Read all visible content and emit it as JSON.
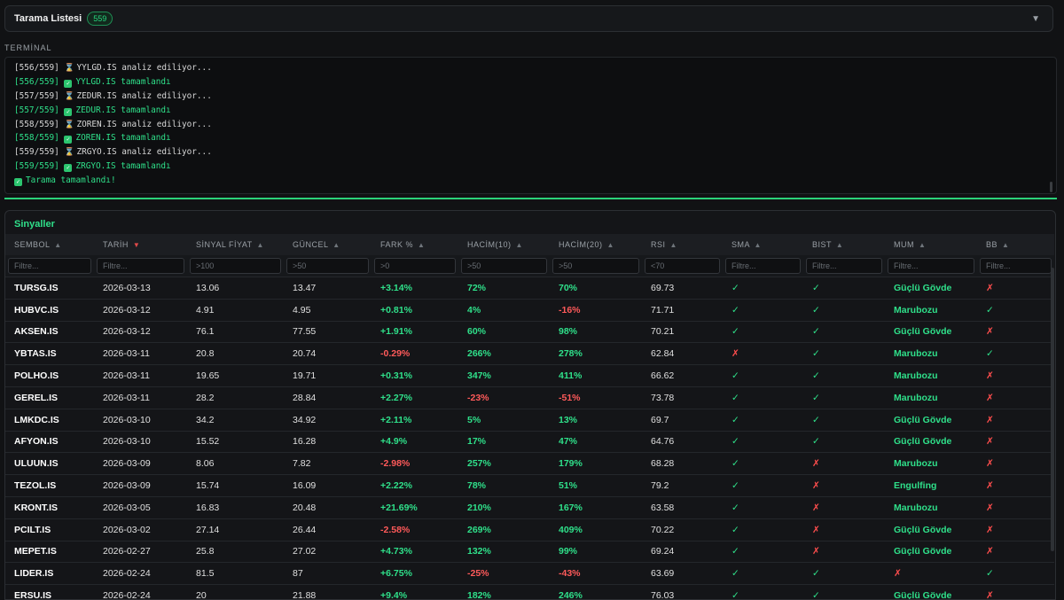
{
  "header": {
    "title": "Tarama Listesi",
    "count": "559",
    "chevron": "▼"
  },
  "terminal": {
    "label": "TERMİNAL",
    "lines": [
      {
        "kind": "info",
        "text": "[556/559] ⏳ YYLGD.IS analiz ediliyor..."
      },
      {
        "kind": "success",
        "text": "[556/559] ✅ YYLGD.IS tamamlandı"
      },
      {
        "kind": "info",
        "text": "[557/559] ⏳ ZEDUR.IS analiz ediliyor..."
      },
      {
        "kind": "success",
        "text": "[557/559] ✅ ZEDUR.IS tamamlandı"
      },
      {
        "kind": "info",
        "text": "[558/559] ⏳ ZOREN.IS analiz ediliyor..."
      },
      {
        "kind": "success",
        "text": "[558/559] ✅ ZOREN.IS tamamlandı"
      },
      {
        "kind": "info",
        "text": "[559/559] ⏳ ZRGYO.IS analiz ediliyor..."
      },
      {
        "kind": "success",
        "text": "[559/559] ✅ ZRGYO.IS tamamlandı"
      },
      {
        "kind": "success",
        "text": "✅ Tarama tamamlandı!"
      }
    ]
  },
  "signals": {
    "title": "Sinyaller",
    "columns": [
      {
        "label": "SEMBOL",
        "sort": "▲",
        "active": false,
        "placeholder": "Filtre..."
      },
      {
        "label": "TARİH",
        "sort": "▼",
        "active": true,
        "placeholder": "Filtre..."
      },
      {
        "label": "SİNYAL FİYAT",
        "sort": "▲",
        "active": false,
        "placeholder": ">100"
      },
      {
        "label": "GÜNCEL",
        "sort": "▲",
        "active": false,
        "placeholder": ">50"
      },
      {
        "label": "FARK %",
        "sort": "▲",
        "active": false,
        "placeholder": ">0"
      },
      {
        "label": "HACİM(10)",
        "sort": "▲",
        "active": false,
        "placeholder": ">50"
      },
      {
        "label": "HACİM(20)",
        "sort": "▲",
        "active": false,
        "placeholder": ">50"
      },
      {
        "label": "RSI",
        "sort": "▲",
        "active": false,
        "placeholder": "<70"
      },
      {
        "label": "SMA",
        "sort": "▲",
        "active": false,
        "placeholder": "Filtre..."
      },
      {
        "label": "BIST",
        "sort": "▲",
        "active": false,
        "placeholder": "Filtre..."
      },
      {
        "label": "MUM",
        "sort": "▲",
        "active": false,
        "placeholder": "Filtre..."
      },
      {
        "label": "BB",
        "sort": "▲",
        "active": false,
        "placeholder": "Filtre..."
      }
    ],
    "rows": [
      [
        "TURSG.IS",
        "2026-03-13",
        "13.06",
        "13.47",
        "+3.14%",
        "72%",
        "70%",
        "69.73",
        "✓",
        "✓",
        "Güçlü Gövde",
        "✗"
      ],
      [
        "HUBVC.IS",
        "2026-03-12",
        "4.91",
        "4.95",
        "+0.81%",
        "4%",
        "-16%",
        "71.71",
        "✓",
        "✓",
        "Marubozu",
        "✓"
      ],
      [
        "AKSEN.IS",
        "2026-03-12",
        "76.1",
        "77.55",
        "+1.91%",
        "60%",
        "98%",
        "70.21",
        "✓",
        "✓",
        "Güçlü Gövde",
        "✗"
      ],
      [
        "YBTAS.IS",
        "2026-03-11",
        "20.8",
        "20.74",
        "-0.29%",
        "266%",
        "278%",
        "62.84",
        "✗",
        "✓",
        "Marubozu",
        "✓"
      ],
      [
        "POLHO.IS",
        "2026-03-11",
        "19.65",
        "19.71",
        "+0.31%",
        "347%",
        "411%",
        "66.62",
        "✓",
        "✓",
        "Marubozu",
        "✗"
      ],
      [
        "GEREL.IS",
        "2026-03-11",
        "28.2",
        "28.84",
        "+2.27%",
        "-23%",
        "-51%",
        "73.78",
        "✓",
        "✓",
        "Marubozu",
        "✗"
      ],
      [
        "LMKDC.IS",
        "2026-03-10",
        "34.2",
        "34.92",
        "+2.11%",
        "5%",
        "13%",
        "69.7",
        "✓",
        "✓",
        "Güçlü Gövde",
        "✗"
      ],
      [
        "AFYON.IS",
        "2026-03-10",
        "15.52",
        "16.28",
        "+4.9%",
        "17%",
        "47%",
        "64.76",
        "✓",
        "✓",
        "Güçlü Gövde",
        "✗"
      ],
      [
        "ULUUN.IS",
        "2026-03-09",
        "8.06",
        "7.82",
        "-2.98%",
        "257%",
        "179%",
        "68.28",
        "✓",
        "✗",
        "Marubozu",
        "✗"
      ],
      [
        "TEZOL.IS",
        "2026-03-09",
        "15.74",
        "16.09",
        "+2.22%",
        "78%",
        "51%",
        "79.2",
        "✓",
        "✗",
        "Engulfing",
        "✗"
      ],
      [
        "KRONT.IS",
        "2026-03-05",
        "16.83",
        "20.48",
        "+21.69%",
        "210%",
        "167%",
        "63.58",
        "✓",
        "✗",
        "Marubozu",
        "✗"
      ],
      [
        "PCILT.IS",
        "2026-03-02",
        "27.14",
        "26.44",
        "-2.58%",
        "269%",
        "409%",
        "70.22",
        "✓",
        "✗",
        "Güçlü Gövde",
        "✗"
      ],
      [
        "MEPET.IS",
        "2026-02-27",
        "25.8",
        "27.02",
        "+4.73%",
        "132%",
        "99%",
        "69.24",
        "✓",
        "✗",
        "Güçlü Gövde",
        "✗"
      ],
      [
        "LIDER.IS",
        "2026-02-24",
        "81.5",
        "87",
        "+6.75%",
        "-25%",
        "-43%",
        "63.69",
        "✓",
        "✓",
        "✗",
        "✓"
      ],
      [
        "ERSU.IS",
        "2026-02-24",
        "20",
        "21.88",
        "+9.4%",
        "182%",
        "246%",
        "76.03",
        "✓",
        "✓",
        "Güçlü Gövde",
        "✗"
      ]
    ]
  },
  "colors": {
    "accent": "#2fe08a",
    "negative": "#ff5a5a",
    "background": "#111214"
  }
}
